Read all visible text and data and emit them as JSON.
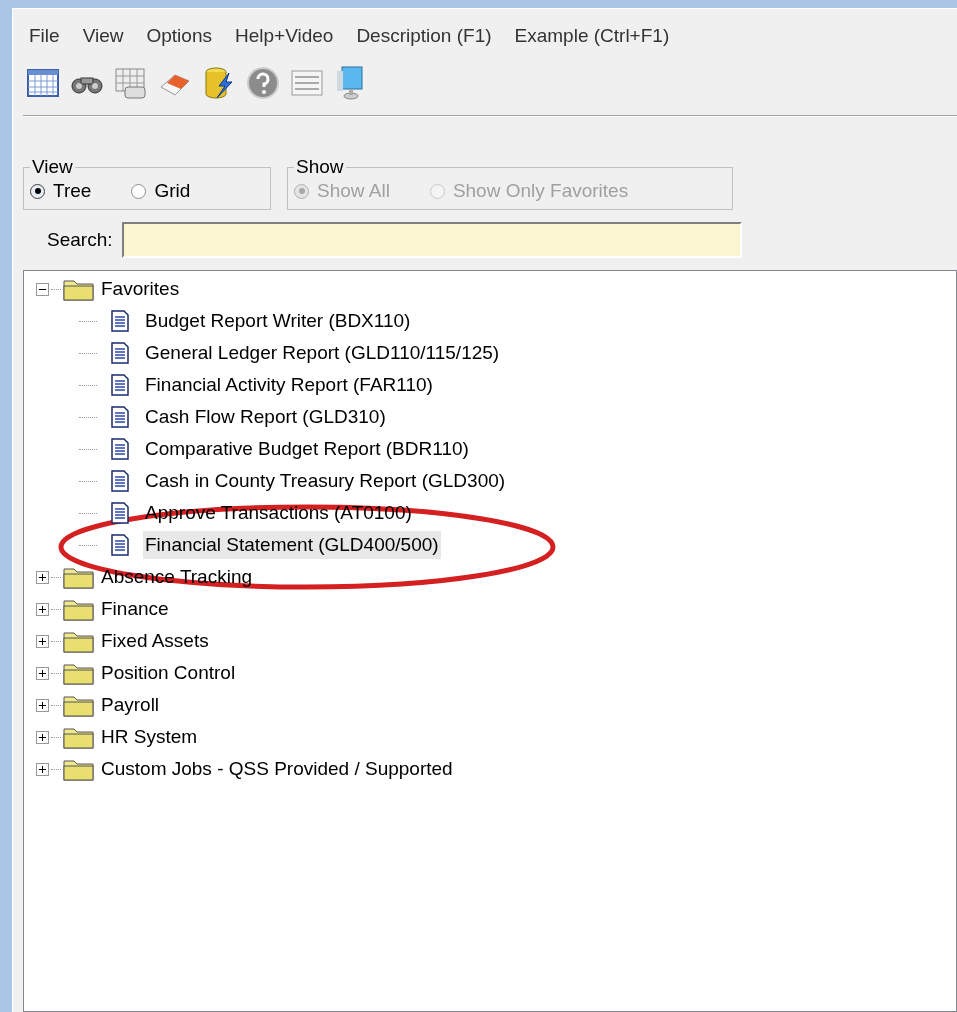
{
  "menu": [
    "File",
    "View",
    "Options",
    "Help+Video",
    "Description (F1)",
    "Example (Ctrl+F1)"
  ],
  "toolbar": [
    {
      "kind": "grid"
    },
    {
      "kind": "binoculars"
    },
    {
      "kind": "report"
    },
    {
      "kind": "eraser"
    },
    {
      "kind": "database"
    },
    {
      "kind": "help"
    },
    {
      "kind": "table"
    },
    {
      "kind": "monitor"
    }
  ],
  "view_group": {
    "title": "View",
    "options": [
      {
        "label": "Tree",
        "selected": true,
        "disabled": false
      },
      {
        "label": "Grid",
        "selected": false,
        "disabled": false
      }
    ]
  },
  "show_group": {
    "title": "Show",
    "options": [
      {
        "label": "Show All",
        "selected": true,
        "disabled": true
      },
      {
        "label": "Show Only Favorites",
        "selected": false,
        "disabled": true
      }
    ]
  },
  "search": {
    "label": "Search:"
  },
  "tree": [
    {
      "label": "Favorites",
      "expanded": true,
      "children": [
        {
          "label": "Budget Report Writer (BDX110)",
          "selected": false
        },
        {
          "label": "General Ledger Report (GLD110/115/125)",
          "selected": false
        },
        {
          "label": "Financial Activity Report (FAR110)",
          "selected": false
        },
        {
          "label": "Cash Flow Report (GLD310)",
          "selected": false
        },
        {
          "label": "Comparative Budget Report (BDR110)",
          "selected": false
        },
        {
          "label": "Cash in County Treasury Report (GLD300)",
          "selected": false
        },
        {
          "label": "Approve Transactions (AT0100)",
          "selected": false
        },
        {
          "label": "Financial Statement (GLD400/500)",
          "selected": true
        }
      ]
    },
    {
      "label": "Absence Tracking",
      "expanded": false
    },
    {
      "label": "Finance",
      "expanded": false
    },
    {
      "label": "Fixed Assets",
      "expanded": false
    },
    {
      "label": "Position Control",
      "expanded": false
    },
    {
      "label": "Payroll",
      "expanded": false
    },
    {
      "label": "HR System",
      "expanded": false
    },
    {
      "label": "Custom Jobs - QSS Provided / Supported",
      "expanded": false
    }
  ]
}
